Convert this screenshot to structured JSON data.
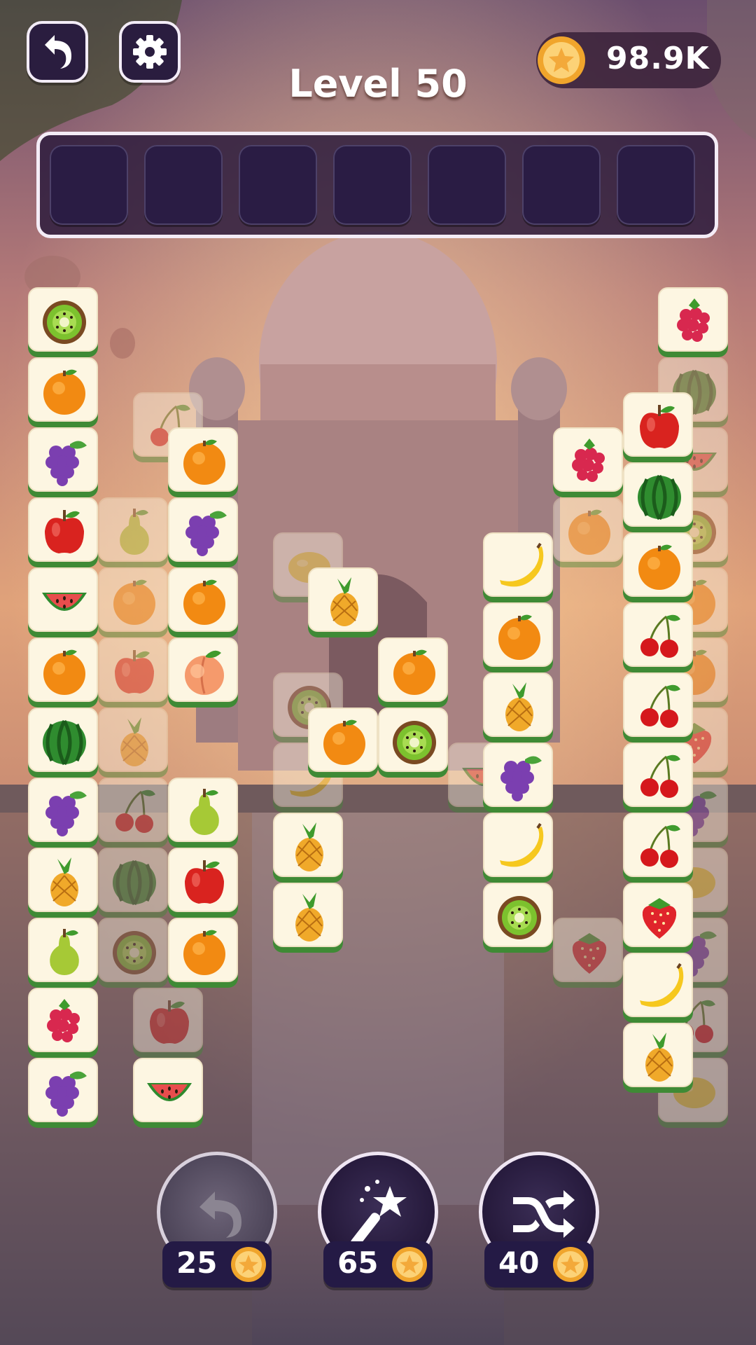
{
  "header": {
    "level_label": "Level 50",
    "coin_balance": "98.9K"
  },
  "tray": {
    "slot_count": 7,
    "filled": 0
  },
  "board": {
    "tiles": [
      {
        "fruit": "kiwi",
        "col": 0,
        "row": 0,
        "active": true
      },
      {
        "fruit": "orange",
        "col": 0,
        "row": 1,
        "active": true
      },
      {
        "fruit": "grapes",
        "col": 0,
        "row": 2,
        "active": true
      },
      {
        "fruit": "apple",
        "col": 0,
        "row": 3,
        "active": true
      },
      {
        "fruit": "watermelon",
        "col": 0,
        "row": 4,
        "active": true
      },
      {
        "fruit": "orange",
        "col": 0,
        "row": 5,
        "active": true
      },
      {
        "fruit": "melon",
        "col": 0,
        "row": 6,
        "active": true
      },
      {
        "fruit": "grapes",
        "col": 0,
        "row": 7,
        "active": true
      },
      {
        "fruit": "pineapple",
        "col": 0,
        "row": 8,
        "active": true
      },
      {
        "fruit": "pear",
        "col": 0,
        "row": 9,
        "active": true
      },
      {
        "fruit": "raspberry",
        "col": 0,
        "row": 10,
        "active": true
      },
      {
        "fruit": "grapes",
        "col": 0,
        "row": 11,
        "active": true
      },
      {
        "fruit": "cherry",
        "col": 1.5,
        "row": 1.5,
        "active": false
      },
      {
        "fruit": "pear",
        "col": 1,
        "row": 3,
        "active": false
      },
      {
        "fruit": "orange",
        "col": 1,
        "row": 4,
        "active": false
      },
      {
        "fruit": "apple",
        "col": 1,
        "row": 5,
        "active": false
      },
      {
        "fruit": "pineapple",
        "col": 1,
        "row": 6,
        "active": false
      },
      {
        "fruit": "cherry",
        "col": 1,
        "row": 7,
        "active": false
      },
      {
        "fruit": "melon",
        "col": 1,
        "row": 8,
        "active": false
      },
      {
        "fruit": "kiwi",
        "col": 1,
        "row": 9,
        "active": false
      },
      {
        "fruit": "apple",
        "col": 1.5,
        "row": 10,
        "active": false
      },
      {
        "fruit": "orange",
        "col": 2,
        "row": 2,
        "active": true
      },
      {
        "fruit": "grapes",
        "col": 2,
        "row": 3,
        "active": true
      },
      {
        "fruit": "orange",
        "col": 2,
        "row": 4,
        "active": true
      },
      {
        "fruit": "peach",
        "col": 2,
        "row": 5,
        "active": true
      },
      {
        "fruit": "pear",
        "col": 2,
        "row": 7,
        "active": true
      },
      {
        "fruit": "apple",
        "col": 2,
        "row": 8,
        "active": true
      },
      {
        "fruit": "orange",
        "col": 2,
        "row": 9,
        "active": true
      },
      {
        "fruit": "watermelon",
        "col": 1.5,
        "row": 11,
        "active": true
      },
      {
        "fruit": "lemon",
        "col": 3.5,
        "row": 3.5,
        "active": false
      },
      {
        "fruit": "kiwi",
        "col": 3.5,
        "row": 5.5,
        "active": false
      },
      {
        "fruit": "banana",
        "col": 3.5,
        "row": 6.5,
        "active": false
      },
      {
        "fruit": "pineapple",
        "col": 4,
        "row": 4,
        "active": true
      },
      {
        "fruit": "pineapple",
        "col": 3.5,
        "row": 7.5,
        "active": true
      },
      {
        "fruit": "pineapple",
        "col": 3.5,
        "row": 8.5,
        "active": true
      },
      {
        "fruit": "orange",
        "col": 4,
        "row": 6,
        "active": true
      },
      {
        "fruit": "orange",
        "col": 5,
        "row": 5,
        "active": true
      },
      {
        "fruit": "kiwi",
        "col": 5,
        "row": 6,
        "active": true
      },
      {
        "fruit": "watermelon",
        "col": 6,
        "row": 6.5,
        "active": false
      },
      {
        "fruit": "banana",
        "col": 6.5,
        "row": 3.5,
        "active": true
      },
      {
        "fruit": "orange",
        "col": 6.5,
        "row": 4.5,
        "active": true
      },
      {
        "fruit": "pineapple",
        "col": 6.5,
        "row": 5.5,
        "active": true
      },
      {
        "fruit": "grapes",
        "col": 6.5,
        "row": 6.5,
        "active": true
      },
      {
        "fruit": "banana",
        "col": 6.5,
        "row": 7.5,
        "active": true
      },
      {
        "fruit": "kiwi",
        "col": 6.5,
        "row": 8.5,
        "active": true
      },
      {
        "fruit": "raspberry",
        "col": 7.5,
        "row": 2,
        "active": true
      },
      {
        "fruit": "orange",
        "col": 7.5,
        "row": 3,
        "active": false
      },
      {
        "fruit": "strawberry",
        "col": 7.5,
        "row": 9,
        "active": false
      },
      {
        "fruit": "apple",
        "col": 8.5,
        "row": 1.5,
        "active": true
      },
      {
        "fruit": "melon",
        "col": 8.5,
        "row": 2.5,
        "active": true
      },
      {
        "fruit": "orange",
        "col": 8.5,
        "row": 3.5,
        "active": true
      },
      {
        "fruit": "cherry",
        "col": 8.5,
        "row": 4.5,
        "active": true
      },
      {
        "fruit": "cherry",
        "col": 8.5,
        "row": 5.5,
        "active": true
      },
      {
        "fruit": "cherry",
        "col": 8.5,
        "row": 6.5,
        "active": true
      },
      {
        "fruit": "cherry",
        "col": 8.5,
        "row": 7.5,
        "active": true
      },
      {
        "fruit": "strawberry",
        "col": 8.5,
        "row": 8.5,
        "active": true
      },
      {
        "fruit": "banana",
        "col": 8.5,
        "row": 9.5,
        "active": true
      },
      {
        "fruit": "pineapple",
        "col": 8.5,
        "row": 10.5,
        "active": true
      },
      {
        "fruit": "raspberry",
        "col": 9,
        "row": 0,
        "active": true
      },
      {
        "fruit": "melon",
        "col": 9,
        "row": 1,
        "active": false
      },
      {
        "fruit": "watermelon",
        "col": 9,
        "row": 2,
        "active": false
      },
      {
        "fruit": "kiwi",
        "col": 9,
        "row": 3,
        "active": false
      },
      {
        "fruit": "orange",
        "col": 9,
        "row": 4,
        "active": false
      },
      {
        "fruit": "orange",
        "col": 9,
        "row": 5,
        "active": false
      },
      {
        "fruit": "strawberry",
        "col": 9,
        "row": 6,
        "active": false
      },
      {
        "fruit": "grapes",
        "col": 9,
        "row": 7,
        "active": false
      },
      {
        "fruit": "lemon",
        "col": 9,
        "row": 8,
        "active": false
      },
      {
        "fruit": "grapes",
        "col": 9,
        "row": 9,
        "active": false
      },
      {
        "fruit": "cherry",
        "col": 9,
        "row": 10,
        "active": false
      },
      {
        "fruit": "lemon",
        "col": 9,
        "row": 11,
        "active": false
      }
    ]
  },
  "powerups": [
    {
      "name": "undo",
      "cost": "25",
      "enabled": false
    },
    {
      "name": "magic-wand",
      "cost": "65",
      "enabled": true
    },
    {
      "name": "shuffle",
      "cost": "40",
      "enabled": true
    }
  ],
  "colors": {
    "tile_face": "#fdf6e2",
    "tile_base": "#3f8a35",
    "tray": "#2a1c44",
    "coin": "#f6b73c"
  }
}
